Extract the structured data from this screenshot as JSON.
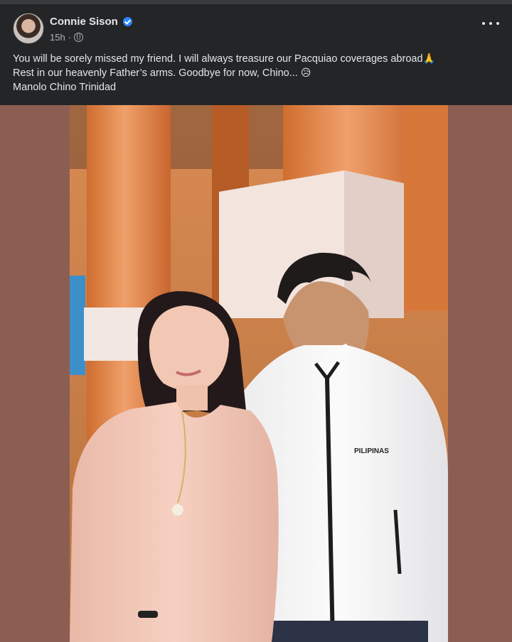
{
  "post": {
    "author_name": "Connie Sison",
    "timestamp": "15h",
    "meta_separator": "·",
    "text_line_1": "You will be sorely missed my friend. I will always treasure our Pacquiao coverages abroad",
    "text_line_1_emoji": "🙏",
    "text_line_2": "Rest in our heavenly Father’s arms. Goodbye for now, Chino...",
    "text_line_2_emoji": "😥",
    "text_line_3": "Manolo Chino Trinidad"
  },
  "photo": {
    "jacket_text": "PILIPINAS"
  },
  "colors": {
    "header_background": "#242526",
    "text_primary": "#e4e6eb",
    "text_secondary": "#b0b3b8",
    "verified_badge": "#2d88ff",
    "page_background": "#8c5e52"
  },
  "icons": {
    "verified": "verified-badge-icon",
    "audience": "globe-icon",
    "more": "more-options-icon"
  }
}
